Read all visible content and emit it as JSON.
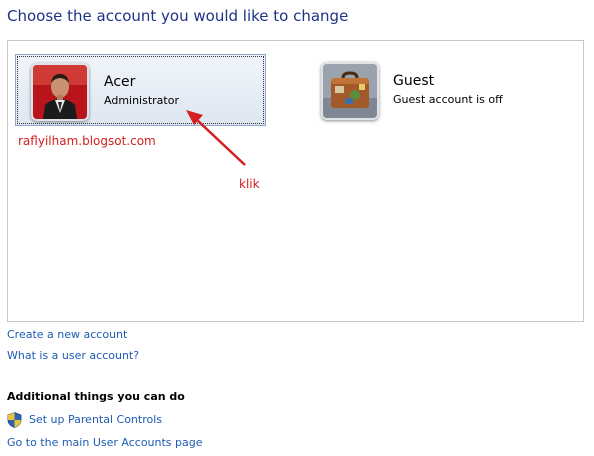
{
  "page": {
    "title": "Choose the account you would like to change"
  },
  "accounts": [
    {
      "name": "Acer",
      "type": "Administrator",
      "avatar_icon": "user-photo-icon"
    },
    {
      "name": "Guest",
      "type": "Guest account is off",
      "avatar_icon": "suitcase-icon"
    }
  ],
  "annotations": {
    "watermark": "raflyilham.blogsot.com",
    "klik": "klik"
  },
  "links": {
    "create": "Create a new account",
    "what_is": "What is a user account?"
  },
  "additional": {
    "heading": "Additional things you can do",
    "parental": "Set up Parental Controls",
    "main_page": "Go to the main User Accounts page"
  },
  "colors": {
    "title": "#1e3287",
    "link": "#1f5bb3",
    "annotation": "#d42020",
    "selected_tile": "#dde6f1"
  }
}
